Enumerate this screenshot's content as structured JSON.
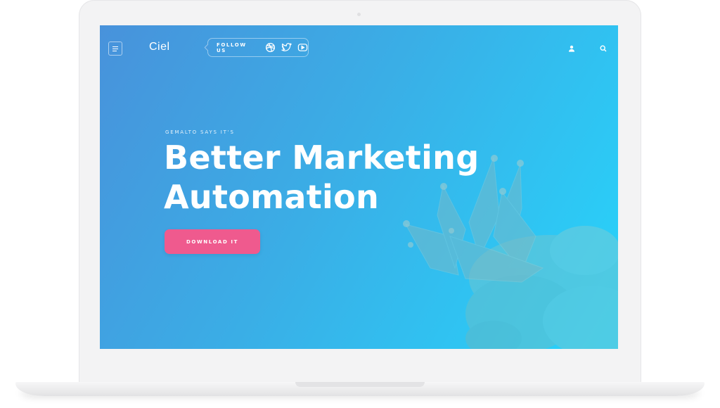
{
  "header": {
    "logo": "Ciel",
    "follow_label": "FOLLOW US",
    "social_icons": [
      "dribbble-icon",
      "twitter-icon",
      "youtube-icon"
    ],
    "right_icons": [
      "user-icon",
      "search-icon"
    ]
  },
  "hero": {
    "eyebrow": "GEMALTO SAYS IT'S",
    "headline_line1": "Better Marketing",
    "headline_line2": "Automation",
    "cta_label": "DOWNLOAD IT"
  },
  "colors": {
    "gradient_start": "#4892db",
    "gradient_end": "#27d4fb",
    "cta": "#ef5a8e",
    "text": "#ffffff"
  }
}
